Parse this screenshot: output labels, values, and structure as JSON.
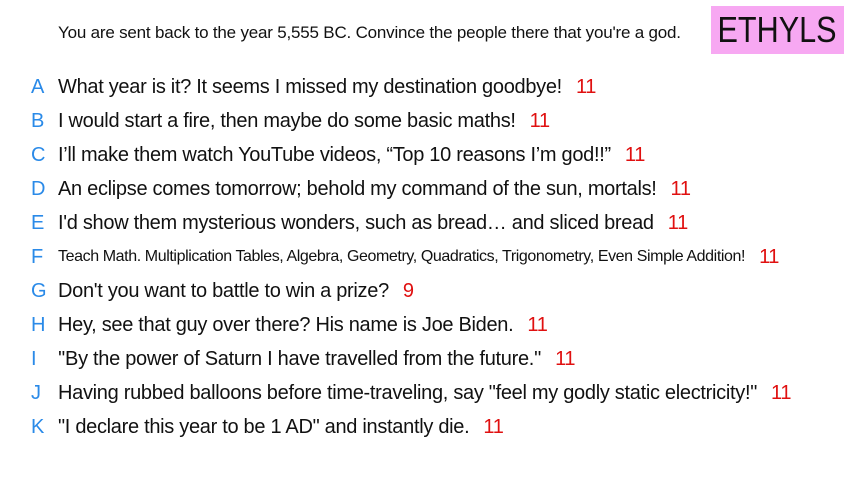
{
  "prompt": "You are sent back to the year 5,555 BC. Convince the people there that you're a god.",
  "badge": "ETHYLS",
  "colors": {
    "letter": "#2a8ae8",
    "score": "#e01010",
    "badge_bg": "#f7a8f2"
  },
  "answers": [
    {
      "letter": "A",
      "text": "What year is it? It seems I missed my destination goodbye!",
      "score": "11"
    },
    {
      "letter": "B",
      "text": "I would start a fire, then maybe do some basic maths!",
      "score": "11"
    },
    {
      "letter": "C",
      "text": "I’ll make them watch YouTube videos, “Top 10 reasons I’m god!!”",
      "score": "11"
    },
    {
      "letter": "D",
      "text": "An eclipse comes tomorrow; behold my command of the sun, mortals!",
      "score": "11"
    },
    {
      "letter": "E",
      "text": "I'd show them mysterious wonders, such as bread… and sliced bread",
      "score": "11"
    },
    {
      "letter": "F",
      "text": "Teach Math. Multiplication Tables, Algebra, Geometry, Quadratics, Trigonometry, Even Simple Addition!",
      "score": "11"
    },
    {
      "letter": "G",
      "text": "Don't you want to battle to win a prize?",
      "score": "9"
    },
    {
      "letter": "H",
      "text": "Hey, see that guy over there? His name is Joe Biden.",
      "score": "11"
    },
    {
      "letter": "I",
      "text": "''By the power of Saturn I have travelled from the future.''",
      "score": "11"
    },
    {
      "letter": "J",
      "text": "Having rubbed balloons before time-traveling, say \"feel my godly static electricity!\"",
      "score": "11"
    },
    {
      "letter": "K",
      "text": "\"I declare this year to be 1 AD\" and instantly die.",
      "score": "11"
    }
  ]
}
